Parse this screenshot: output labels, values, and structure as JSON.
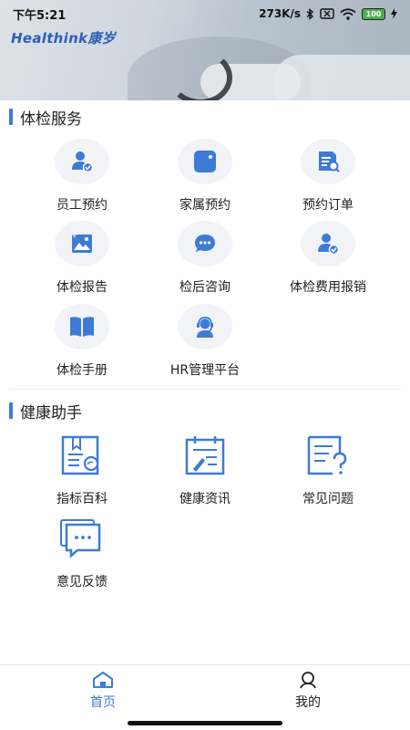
{
  "status_bar": {
    "time": "下午5:21",
    "network_speed": "273K/s",
    "battery": "100"
  },
  "banner": {
    "brand_logo": "Healthink康岁"
  },
  "sections": {
    "exam_services": {
      "title": "体检服务",
      "items": [
        {
          "label": "员工预约",
          "icon": "user-check-icon"
        },
        {
          "label": "家属预约",
          "icon": "tablet-icon"
        },
        {
          "label": "预约订单",
          "icon": "order-search-icon"
        },
        {
          "label": "体检报告",
          "icon": "report-image-icon"
        },
        {
          "label": "检后咨询",
          "icon": "chat-bubble-icon"
        },
        {
          "label": "体检费用报销",
          "icon": "user-check-icon"
        },
        {
          "label": "体检手册",
          "icon": "book-icon"
        },
        {
          "label": "HR管理平台",
          "icon": "support-agent-icon"
        }
      ]
    },
    "health_assistant": {
      "title": "健康助手",
      "items": [
        {
          "label": "指标百科",
          "icon": "book-search-icon"
        },
        {
          "label": "健康资讯",
          "icon": "notepad-pen-icon"
        },
        {
          "label": "常见问题",
          "icon": "question-doc-icon"
        },
        {
          "label": "意见反馈",
          "icon": "feedback-chat-icon"
        }
      ]
    }
  },
  "tabbar": {
    "home": "首页",
    "mine": "我的"
  },
  "colors": {
    "accent": "#3d7bd6",
    "icon_bg": "#f1f3f6"
  }
}
